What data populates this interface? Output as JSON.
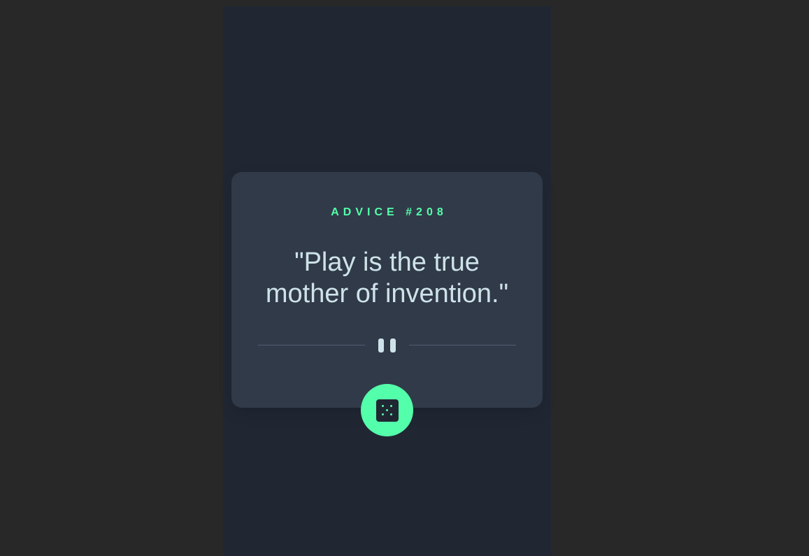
{
  "card": {
    "advice_label": "ADVICE #208",
    "quote": "\"Play is the true mother of invention.\""
  },
  "icons": {
    "divider": "pause-icon",
    "button": "dice-icon"
  },
  "colors": {
    "accent": "#53ffaa",
    "card_background": "#313a48",
    "page_background": "#202733",
    "text": "#cee3e9",
    "divider": "#4f5d74"
  }
}
